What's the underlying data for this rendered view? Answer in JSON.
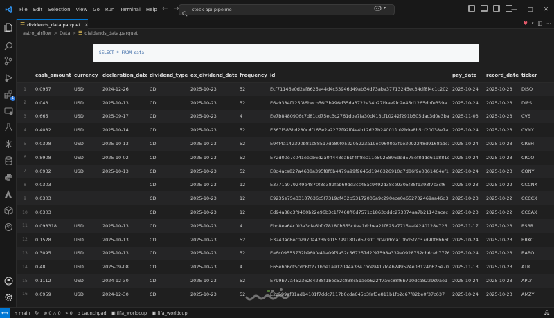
{
  "window": {
    "menu": [
      "File",
      "Edit",
      "Selection",
      "View",
      "Go",
      "Run",
      "Terminal",
      "Help"
    ],
    "search_text": "stock-api-pipeline"
  },
  "tab": {
    "label": "dividends_data.parquet",
    "close": "×"
  },
  "breadcrumb": {
    "segments": [
      "astro_airflow",
      "Data",
      "dividends_data.parquet"
    ],
    "sep": ">"
  },
  "query": {
    "text": "SELECT * FROM data"
  },
  "table": {
    "columns": [
      "",
      "cash_amount",
      "currency",
      "declaration_date",
      "dividend_type",
      "ex_dividend_date",
      "frequency",
      "id",
      "pay_date",
      "record_date",
      "ticker"
    ],
    "rows": [
      [
        "1",
        "0.0957",
        "USD",
        "2024-12-26",
        "CD",
        "2025-10-23",
        "52",
        "Ecf71146e0d2ef8625e44d4c53946d49ab34d73aba37713245ec34df8f4c1c202",
        "2025-10-24",
        "2025-10-23",
        "DISO"
      ],
      [
        "2",
        "0.043",
        "USD",
        "2025-10-13",
        "CD",
        "2025-10-23",
        "52",
        "E6a9384f125f86becb56f3b996d35da3722e34b27f9ae9fc2e45d1265dbfe359a",
        "2025-10-24",
        "2025-10-23",
        "DIPS"
      ],
      [
        "3",
        "0.665",
        "USD",
        "2025-09-17",
        "CD",
        "2025-10-23",
        "4",
        "Ee7b8480906c7d81cd75ec3c2761dbe7fa30d413cf10242f291b505dac3d0e3ba",
        "2025-11-03",
        "2025-10-23",
        "CVS"
      ],
      [
        "4",
        "0.4082",
        "USD",
        "2025-10-14",
        "CD",
        "2025-10-23",
        "52",
        "E367f583bd280cdf165e2a2277f92ff4e4b12d27b24001fc02b9a8b5cf20038e7a",
        "2025-10-24",
        "2025-10-23",
        "CVNY"
      ],
      [
        "5",
        "0.0398",
        "USD",
        "2025-10-13",
        "CD",
        "2025-10-23",
        "52",
        "E94f4a142390b81c88517db80f052205223a19ec9600e3f9e2092248d9168adc3",
        "2025-10-24",
        "2025-10-23",
        "CRSH"
      ],
      [
        "6",
        "0.8908",
        "USD",
        "2025-10-02",
        "CD",
        "2025-10-23",
        "52",
        "E72d00e7c041ee0b6d2a0ff448eab1f4ff8e011e5925896ddd575ef8ddd619881e",
        "2025-10-24",
        "2025-10-23",
        "CRCO"
      ],
      [
        "7",
        "0.0932",
        "USD",
        "2025-10-13",
        "CD",
        "2025-10-23",
        "52",
        "E8d4aca827a4638a395f8f0b4479a99f9645d1946326910d7d86f9e0361464ef1",
        "2025-10-24",
        "2025-10-23",
        "CONY"
      ],
      [
        "8",
        "0.0303",
        "",
        "",
        "CD",
        "2025-10-23",
        "12",
        "E3771a079249b4870f3e389fab69dd3cc45ac9492d38ce9305f38f1393f7c3cf6",
        "2025-10-23",
        "2025-10-22",
        "CCCNX"
      ],
      [
        "9",
        "0.0303",
        "",
        "",
        "CD",
        "2025-10-23",
        "12",
        "E9235e75e33107636c5f7319cf432b53172005a9c290ece0e652702469aa46d37",
        "2025-10-23",
        "2025-10-22",
        "CCCCX"
      ],
      [
        "10",
        "0.0303",
        "",
        "",
        "CD",
        "2025-10-23",
        "12",
        "Ed94a88c3f9400b22e96b3c1f7468ff0d7571c1863dddc273074aa7b21142acec",
        "2025-10-23",
        "2025-10-22",
        "CCCAX"
      ],
      [
        "11",
        "0.098318",
        "USD",
        "2025-10-13",
        "CD",
        "2025-10-23",
        "4",
        "Ebd8ea64cf03a3cf46bfb78180b655c0ea1dcbea21f825e7715eaf4240128e726",
        "2025-11-17",
        "2025-10-23",
        "BSBR"
      ],
      [
        "12",
        "0.1528",
        "USD",
        "2025-10-13",
        "CD",
        "2025-10-23",
        "52",
        "E3243ac8ec02970a423b30157991807d5730f1b040dcca10bd5f7c37d90f8b660",
        "2025-10-24",
        "2025-10-23",
        "BRKC"
      ],
      [
        "13",
        "0.3095",
        "USD",
        "2025-10-13",
        "CD",
        "2025-10-23",
        "52",
        "Ea6c09555732b960fe41a09f5a52c567257d2f97598a339e0928752cb6ceb7776",
        "2025-10-24",
        "2025-10-23",
        "BABO"
      ],
      [
        "14",
        "0.48",
        "USD",
        "2025-09-08",
        "CD",
        "2025-10-23",
        "4",
        "E65ebb6df5cdc6ff271bbe1a912044a3347bce9417fc4b249524e03124b625e70",
        "2025-11-13",
        "2025-10-23",
        "ATR"
      ],
      [
        "15",
        "0.1112",
        "USD",
        "2024-12-30",
        "CD",
        "2025-10-23",
        "52",
        "E799b77a452362c4288f1bec52c838c51aeb622ff7a6c88f6b790dca8229c9ae1",
        "2025-10-24",
        "2025-10-23",
        "APLY"
      ],
      [
        "16",
        "0.0959",
        "USD",
        "2024-12-30",
        "CD",
        "2025-10-23",
        "52",
        "E2c599af81ad14101f7ddc7117b0cde645b3faf3e811b1fb2c67f82be0f37c637",
        "2025-10-24",
        "2025-10-23",
        "AMZY"
      ]
    ]
  },
  "statusbar": {
    "branch": "main",
    "errors": "0",
    "warnings": "0",
    "ports": "0",
    "launchpad": "Launchpad",
    "env1": "fifa_worldcup",
    "env2": "fifa_worldcup"
  },
  "colors": {
    "accent": "#0078d4",
    "parquet_icon": "#e8c55a",
    "query_text": "#3465a4"
  }
}
